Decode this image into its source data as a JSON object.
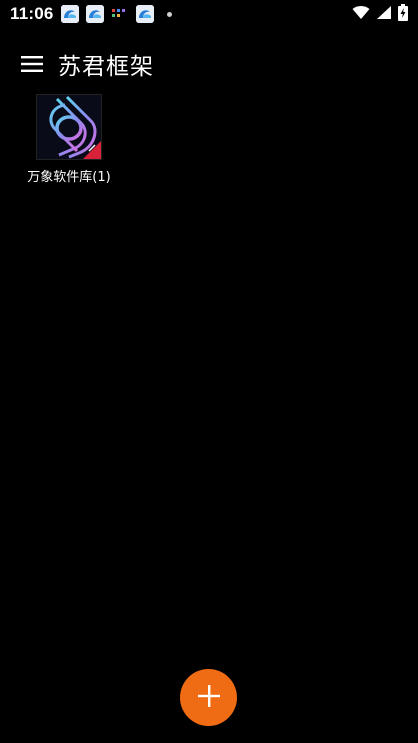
{
  "status_bar": {
    "time": "11:06",
    "icons": [
      "app-notification-icon",
      "app-notification-icon",
      "multi-dot-icon",
      "app-notification-icon",
      "more-dot-icon"
    ],
    "right_icons": [
      "wifi-icon",
      "cellular-signal-icon",
      "battery-charging-icon"
    ]
  },
  "app_bar": {
    "title": "苏君框架",
    "menu_icon": "hamburger-menu-icon"
  },
  "apps": [
    {
      "label": "万象软件库(1)",
      "icon": "app-logo-icon"
    }
  ],
  "fab": {
    "icon": "plus-icon",
    "color": "#ef6c14"
  },
  "colors": {
    "background": "#000000",
    "text": "#ffffff",
    "accent": "#ef6c14"
  }
}
